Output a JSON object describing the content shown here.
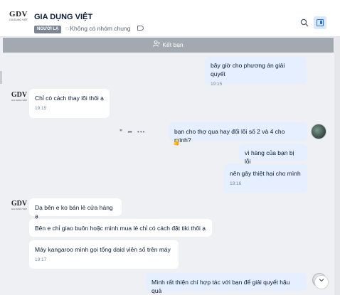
{
  "header": {
    "logo_main": "GDV",
    "logo_sub": "GIA DỤNG VIỆT",
    "title": "GIA DỤNG VIỆT",
    "tag": "NGƯỜI LẠ",
    "group_text": "Không có nhóm chung",
    "icons": [
      "tag-icon",
      "search-icon",
      "panel-toggle-icon"
    ]
  },
  "connect_bar": {
    "label": "Kết bạn"
  },
  "messages": [
    {
      "from": "me",
      "text": "bây giờ cho phương án giải quyết",
      "time": "19:15"
    },
    {
      "from": "them",
      "text": "Chỉ có cách thay lõi thôi ạ",
      "time": "19:15"
    },
    {
      "from": "me",
      "text": "bạn cho thợ qua hay đổi lõi số 2 và 4 cho mình?"
    },
    {
      "from": "me",
      "text": "vì hàng của bạn bị lỗi"
    },
    {
      "from": "me",
      "text": "nên gây thiệt hại cho mình",
      "time": "19:16"
    },
    {
      "from": "them",
      "text": "Dạ bên e ko bán lẻ cửa hàng ạ"
    },
    {
      "from": "them",
      "text": "Bên e chỉ giao buôn hoặc mình mua lẻ chỉ có cách đặt tiki thôi ạ"
    },
    {
      "from": "them",
      "text": "Máy kangaroo mình gọi tổng daid viên số trên máy",
      "time": "19:17"
    },
    {
      "from": "me",
      "text": "Mình rất thiện chí hợp tác với bạn để giải quyết hậu quả"
    }
  ],
  "actions": {
    "quote": "❞",
    "forward": "➦",
    "more": "•••"
  },
  "colors": {
    "my_bubble": "#e5efff",
    "their_bubble": "#ffffff",
    "accent": "#1e6fe8",
    "bar": "#a3a9b1"
  }
}
